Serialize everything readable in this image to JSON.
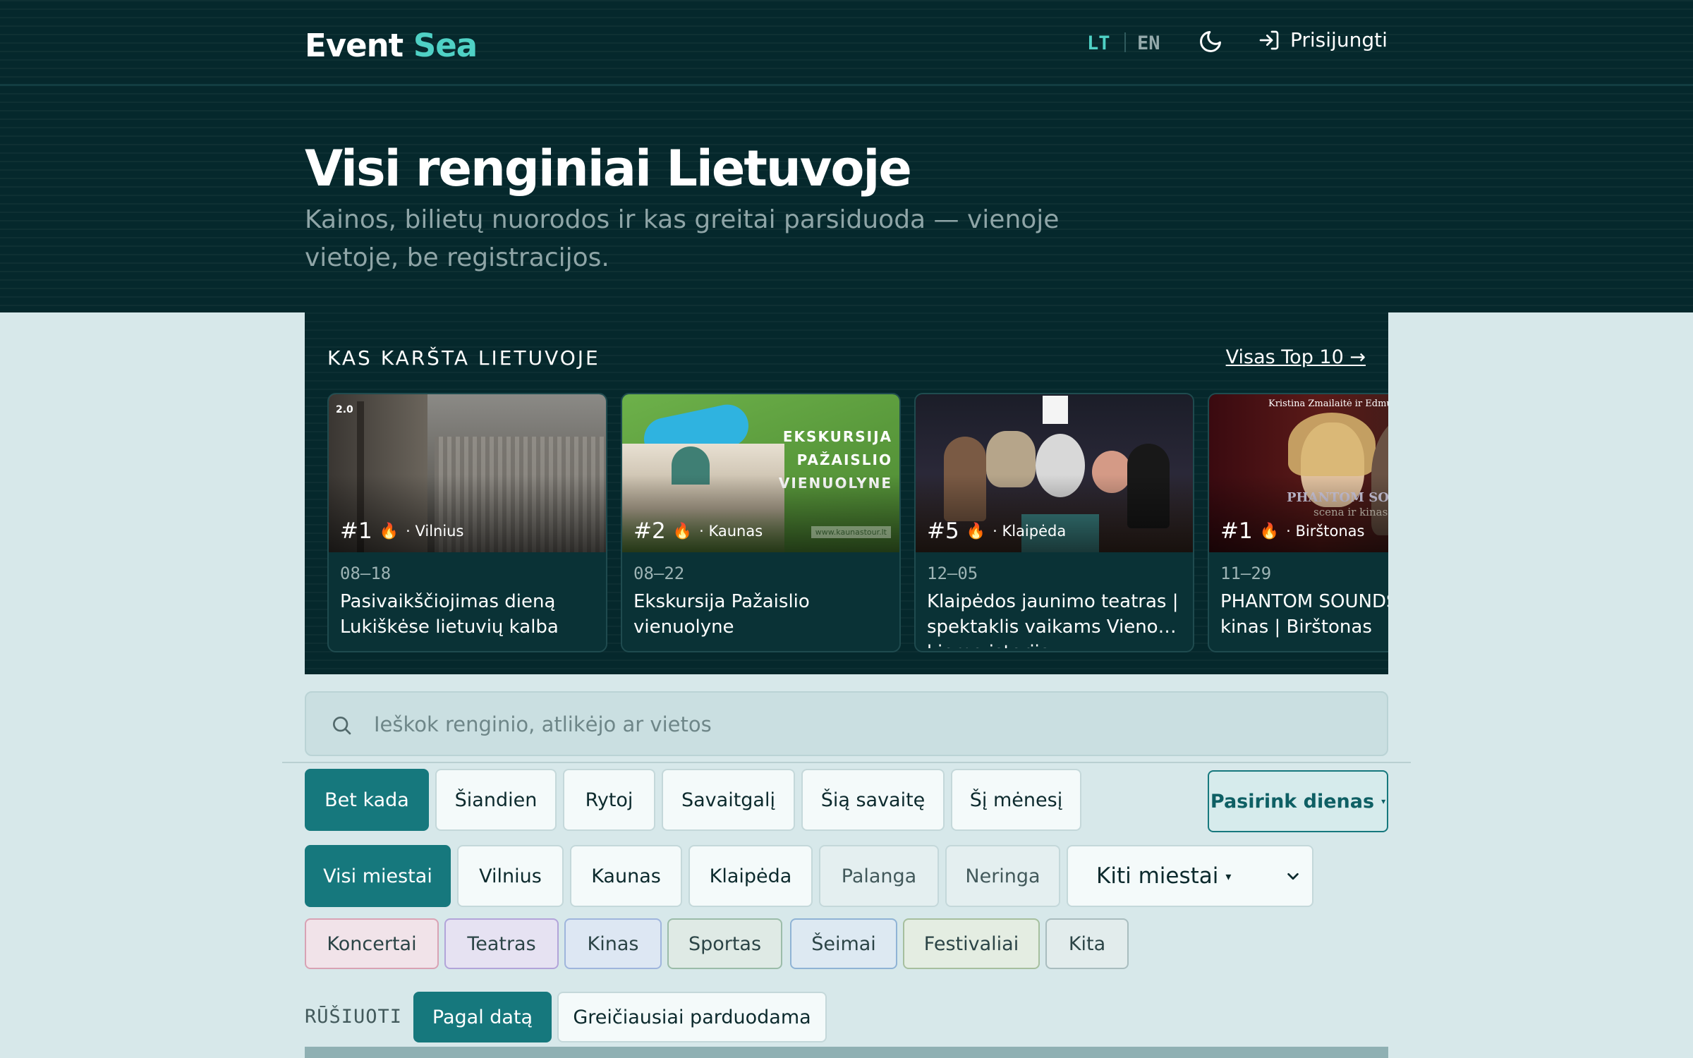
{
  "header": {
    "logo_main": "Event",
    "logo_accent": "Sea",
    "lang_lt": "LT",
    "lang_en": "EN",
    "theme_icon": "moon-icon",
    "login_icon": "sign-in-icon",
    "login_label": "Prisijungti"
  },
  "hero": {
    "title": "Visi renginiai Lietuvoje",
    "subtitle": "Kainos, bilietų nuorodos ir kas greitai parsiduoda — vienoje vietoje, be registracijos."
  },
  "hot": {
    "title": "KAS KARŠTA LIETUVOJE",
    "link": "Visas Top 10 →",
    "cards": [
      {
        "rank": "#1",
        "city": "· Vilnius",
        "date": "08–18",
        "title": "Pasivaikščiojimas dieną Lukiškėse lietuvių kalba",
        "badge": "2.0"
      },
      {
        "rank": "#2",
        "city": "· Kaunas",
        "date": "08–22",
        "title": "Ekskursija Pažaislio vienuolyne",
        "image_text": "EKSKURSIJA PAŽAISLIO VIENUOLYNE",
        "image_url_text": "www.kaunastour.lt"
      },
      {
        "rank": "#5",
        "city": "· Klaipėda",
        "date": "12–05",
        "title": "Klaipėdos jaunimo teatras | spektaklis vaikams Vieno… kiemo istorija"
      },
      {
        "rank": "#1",
        "city": "· Birštonas",
        "date": "11–29",
        "title": "PHANTOM SOUNDS scena ir kinas | Birštonas",
        "image_text": "Kristina Zmailaitė ir Edmund",
        "image_title": "PHANTOM SOUNDS",
        "image_sub": "scena ir kinas"
      }
    ],
    "fire_icon": "fire-icon"
  },
  "search": {
    "placeholder": "Ieškok renginio, atlikėjo ar vietos",
    "icon": "search-icon"
  },
  "date_filters": [
    "Bet kada",
    "Šiandien",
    "Rytoj",
    "Savaitgalį",
    "Šią savaitę",
    "Šį mėnesį"
  ],
  "date_picker": "Pasirink dienas",
  "city_filters": [
    "Visi miestai",
    "Vilnius",
    "Kaunas",
    "Klaipėda",
    "Palanga",
    "Neringa"
  ],
  "city_select": "Kiti miestai",
  "categories": [
    {
      "label": "Koncertai",
      "bg": "#f1e3e9",
      "border": "#d8a2b4"
    },
    {
      "label": "Teatras",
      "bg": "#e6e2f2",
      "border": "#b2a4d9"
    },
    {
      "label": "Kinas",
      "bg": "#dde7f3",
      "border": "#9fb5dc"
    },
    {
      "label": "Sportas",
      "bg": "#dfeae5",
      "border": "#9bbca9"
    },
    {
      "label": "Šeimai",
      "bg": "#dde9f2",
      "border": "#8fb3d5"
    },
    {
      "label": "Festivaliai",
      "bg": "#e4ede2",
      "border": "#a6bf9e"
    },
    {
      "label": "Kita",
      "bg": "#e2ecec",
      "border": "#a9bdbf"
    }
  ],
  "sort": {
    "label": "RŪŠIUOTI",
    "options": [
      "Pagal datą",
      "Greičiausiai parduodama"
    ]
  },
  "colors": {
    "accent": "#16787d",
    "brand_dark": "#05282c",
    "logo_accent": "#4fd1c5"
  }
}
